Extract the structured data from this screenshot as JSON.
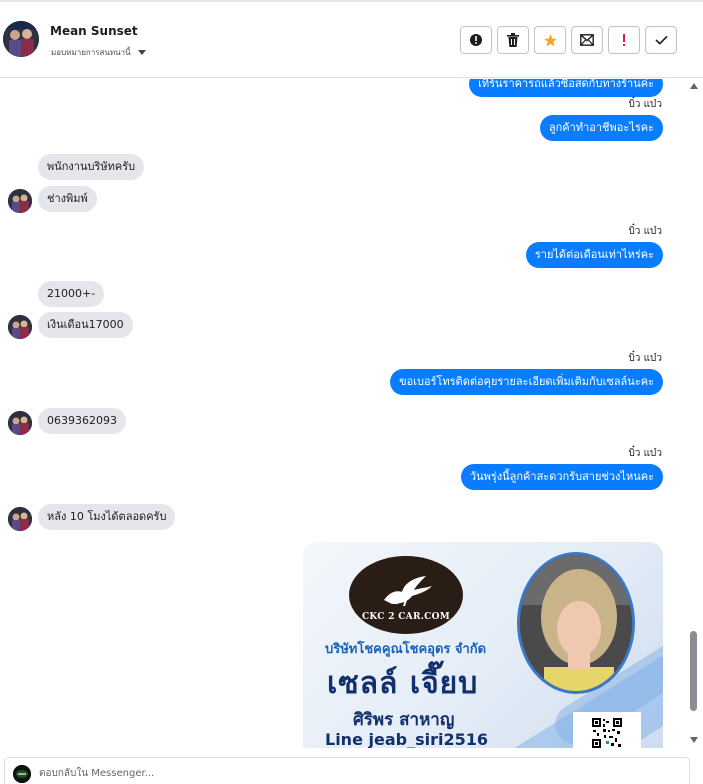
{
  "header": {
    "contact_name": "Mean Sunset",
    "assign_label": "มอบหมายการสนทนานี้",
    "actions": [
      {
        "name": "report-button",
        "icon": "alert-circle-icon",
        "color": "#1c1e21"
      },
      {
        "name": "delete-button",
        "icon": "trash-icon",
        "color": "#1c1e21"
      },
      {
        "name": "star-button",
        "icon": "star-icon",
        "color": "#f5a623"
      },
      {
        "name": "mark-unread-button",
        "icon": "envelope-icon",
        "color": "#1c1e21"
      },
      {
        "name": "follow-up-button",
        "icon": "exclamation-icon",
        "color": "#e41e3f"
      },
      {
        "name": "mark-done-button",
        "icon": "check-icon",
        "color": "#1c1e21"
      }
    ]
  },
  "messages": [
    {
      "direction": "out",
      "text": "เทิร์นราคารถแล้วซื้อสดกับทางร้านค่ะ",
      "sender": ""
    },
    {
      "direction": "out",
      "text": "ลูกค้าทำอาชีพอะไรคะ",
      "sender": "บิ๋ว แบ๋ว"
    },
    {
      "direction": "in",
      "text": "พนักงานบริษัทครับ"
    },
    {
      "direction": "in",
      "text": "ช่างพิมพ์"
    },
    {
      "direction": "out",
      "text": "รายได้ต่อเดือนเท่าไหร่คะ",
      "sender": "บิ๋ว แบ๋ว"
    },
    {
      "direction": "in",
      "text": "21000+-"
    },
    {
      "direction": "in",
      "text": "เงินเดือน17000"
    },
    {
      "direction": "out",
      "text": "ขอเบอร์โทรติดต่อคุยรายละเอียดเพิ่มเติมกับเซลล์นะคะ",
      "sender": "บิ๋ว แบ๋ว"
    },
    {
      "direction": "in",
      "text": "0639362093"
    },
    {
      "direction": "out",
      "text": "วันพรุ่งนี้ลูกค้าสะดวกรับสายช่วงไหนคะ",
      "sender": "บิ๋ว แบ๋ว"
    },
    {
      "direction": "in",
      "text": "หลัง 10 โมงได้ตลอดครับ"
    }
  ],
  "card": {
    "logo_text": "CKC 2 CAR.COM",
    "company": "บริษัทโชคคูณโชคอุดร จำกัด",
    "seller_nick": "เซลล์ เจี๊ยบ",
    "full_name": "ศิริพร สาหาญ",
    "line_id": "Line  jeab_siri2516"
  },
  "composer": {
    "placeholder": "ตอบกลับใน Messenger..."
  }
}
